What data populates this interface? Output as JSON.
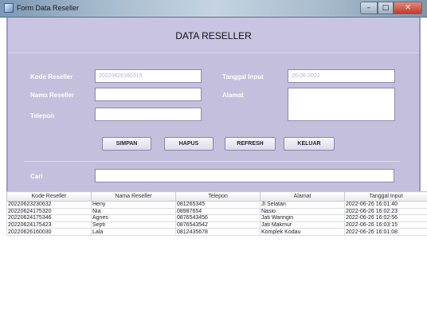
{
  "window": {
    "title": "Form Data Reseller",
    "minimize": "–",
    "maximize": "□",
    "close": "✕"
  },
  "header": {
    "title": "DATA RESELLER"
  },
  "form": {
    "kode_label": "Kode Reseller",
    "kode_value": "20220626160315",
    "nama_label": "Nama Reseller",
    "nama_value": "",
    "telepon_label": "Telepon",
    "telepon_value": "",
    "tanggal_label": "Tanggal Input",
    "tanggal_value": "26-06-2022",
    "alamat_label": "Alamat",
    "alamat_value": ""
  },
  "buttons": {
    "simpan": "SIMPAN",
    "hapus": "HAPUS",
    "refresh": "REFRESH",
    "keluar": "KELUAR"
  },
  "search": {
    "label": "Cari",
    "value": ""
  },
  "table": {
    "columns": [
      "Kode Reseller",
      "Nama Reseller",
      "Telepon",
      "Alamat",
      "Tanggal Input"
    ],
    "rows": [
      [
        "20220623230632",
        "Heny",
        "081265345",
        "Jl Selatan",
        "2022-06-26 16:01:40"
      ],
      [
        "20220624175320",
        "Nia",
        "08987654",
        "Nasio",
        "2022-06-26 16:02:23"
      ],
      [
        "20220624175346",
        "Agnes",
        "0876543456",
        "Jati Waringin",
        "2022-06-26 16:02:56"
      ],
      [
        "20220624175423",
        "Septi",
        "0876543542",
        "Jati Makmur",
        "2022-06-26 16:03:15"
      ],
      [
        "20220626160030",
        "Lala",
        "0812435678",
        "Komplek Kodau",
        "2022-06-26 16:01:08"
      ]
    ]
  },
  "colors": {
    "panel": "#c3bfdc",
    "header": "#c9c4e2",
    "label": "#ffffff"
  }
}
